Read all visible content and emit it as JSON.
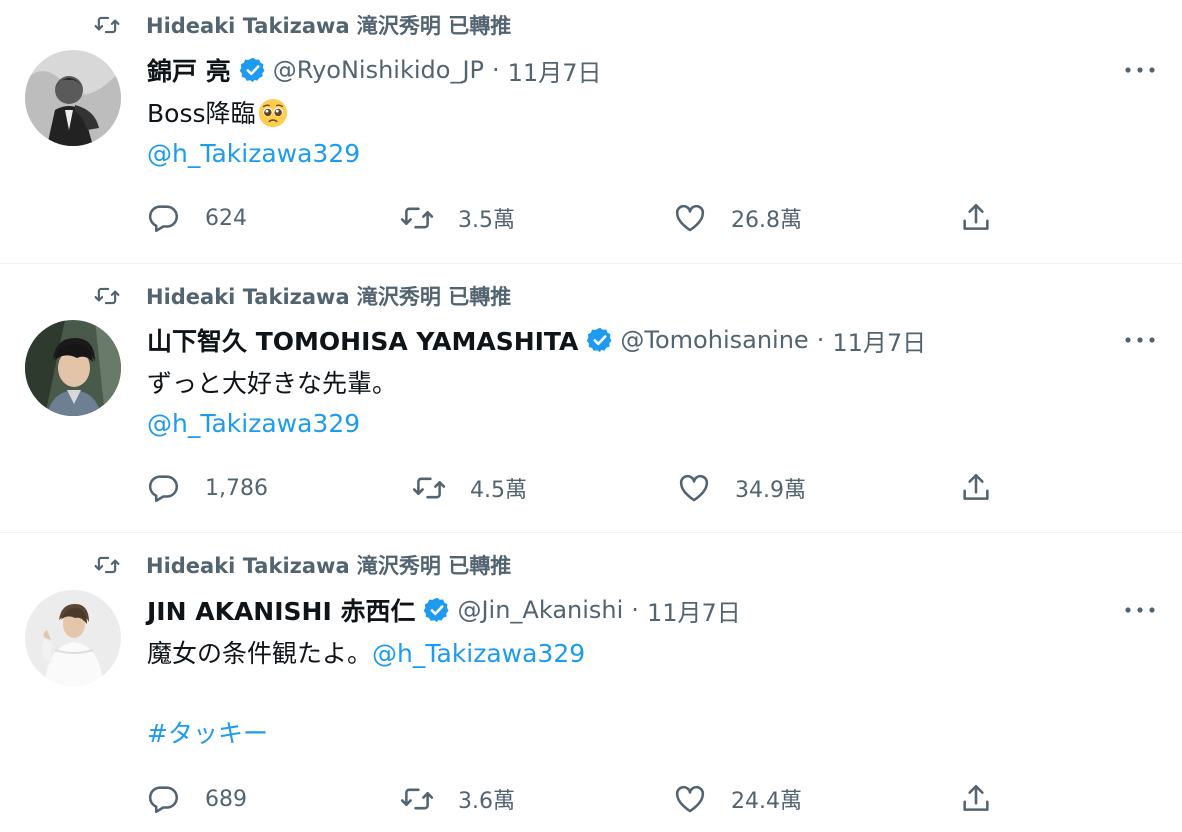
{
  "colors": {
    "accent": "#1d9bf0",
    "muted": "#536471",
    "text": "#0f1419",
    "verified": "#1d9bf0"
  },
  "tweets": [
    {
      "retweeted_by": "Hideaki Takizawa 滝沢秀明 已轉推",
      "author_name": "錦戸 亮",
      "verified": true,
      "handle": "@RyoNishikido_JP",
      "separator": "·",
      "date": "11月7日",
      "text_plain": "Boss降臨",
      "emoji": "pleading-face-icon",
      "mention": "@h_Takizawa329",
      "replies": "624",
      "retweets": "3.5萬",
      "likes": "26.8萬"
    },
    {
      "retweeted_by": "Hideaki Takizawa 滝沢秀明 已轉推",
      "author_name": "山下智久 TOMOHISA YAMASHITA",
      "verified": true,
      "handle": "@Tomohisanine",
      "separator": "·",
      "date": "11月7日",
      "text_plain": "ずっと大好きな先輩。",
      "mention": "@h_Takizawa329",
      "replies": "1,786",
      "retweets": "4.5萬",
      "likes": "34.9萬"
    },
    {
      "retweeted_by": "Hideaki Takizawa 滝沢秀明 已轉推",
      "author_name": "JIN AKANISHI 赤西仁",
      "verified": true,
      "handle": "@Jin_Akanishi",
      "separator": "·",
      "date": "11月7日",
      "text_plain": "魔女の条件観たよ。",
      "mention": "@h_Takizawa329",
      "hashtag": "#タッキー",
      "replies": "689",
      "retweets": "3.6萬",
      "likes": "24.4萬"
    }
  ]
}
